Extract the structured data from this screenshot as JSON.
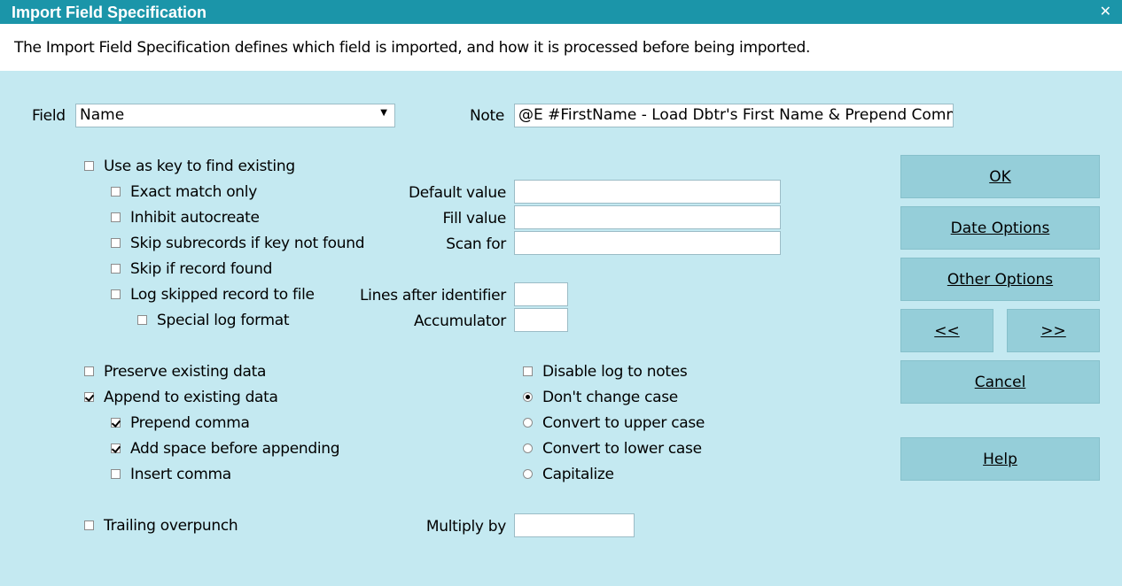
{
  "window": {
    "title": "Import Field Specification"
  },
  "description": "The Import Field Specification defines which field is imported, and how it is processed before being imported.",
  "field": {
    "label": "Field",
    "value": "Name"
  },
  "note": {
    "label": "Note",
    "value": "@E  #FirstName - Load Dbtr's First Name & Prepend Comn"
  },
  "checkboxes": {
    "use_as_key": {
      "label": "Use as key to find existing",
      "checked": false
    },
    "exact_match": {
      "label": "Exact match only",
      "checked": false
    },
    "inhibit_autocreate": {
      "label": "Inhibit autocreate",
      "checked": false
    },
    "skip_subrecords": {
      "label": "Skip subrecords if key not found",
      "checked": false
    },
    "skip_if_found": {
      "label": "Skip if record found",
      "checked": false
    },
    "log_skipped": {
      "label": "Log skipped record to file",
      "checked": false
    },
    "special_log": {
      "label": "Special log format",
      "checked": false
    },
    "preserve_existing": {
      "label": "Preserve existing data",
      "checked": false
    },
    "append_existing": {
      "label": "Append to existing data",
      "checked": true
    },
    "prepend_comma": {
      "label": "Prepend comma",
      "checked": true
    },
    "add_space": {
      "label": "Add space before appending",
      "checked": true
    },
    "insert_comma": {
      "label": "Insert comma",
      "checked": false
    },
    "trailing_overpunch": {
      "label": "Trailing overpunch",
      "checked": false
    },
    "disable_log": {
      "label": "Disable log to notes",
      "checked": false
    }
  },
  "inputs": {
    "default_value": {
      "label": "Default value",
      "value": ""
    },
    "fill_value": {
      "label": "Fill value",
      "value": ""
    },
    "scan_for": {
      "label": "Scan for",
      "value": ""
    },
    "lines_after": {
      "label": "Lines after identifier",
      "value": ""
    },
    "accumulator": {
      "label": "Accumulator",
      "value": ""
    },
    "multiply_by": {
      "label": "Multiply by",
      "value": ""
    }
  },
  "case_options": {
    "selected": "dont_change",
    "dont_change": "Don't change case",
    "upper": "Convert to upper case",
    "lower": "Convert to lower case",
    "capitalize": "Capitalize"
  },
  "buttons": {
    "ok": "OK",
    "date_options": "Date Options",
    "other_options": "Other Options",
    "prev": "<<",
    "next": ">>",
    "cancel": "Cancel",
    "help": "Help"
  }
}
